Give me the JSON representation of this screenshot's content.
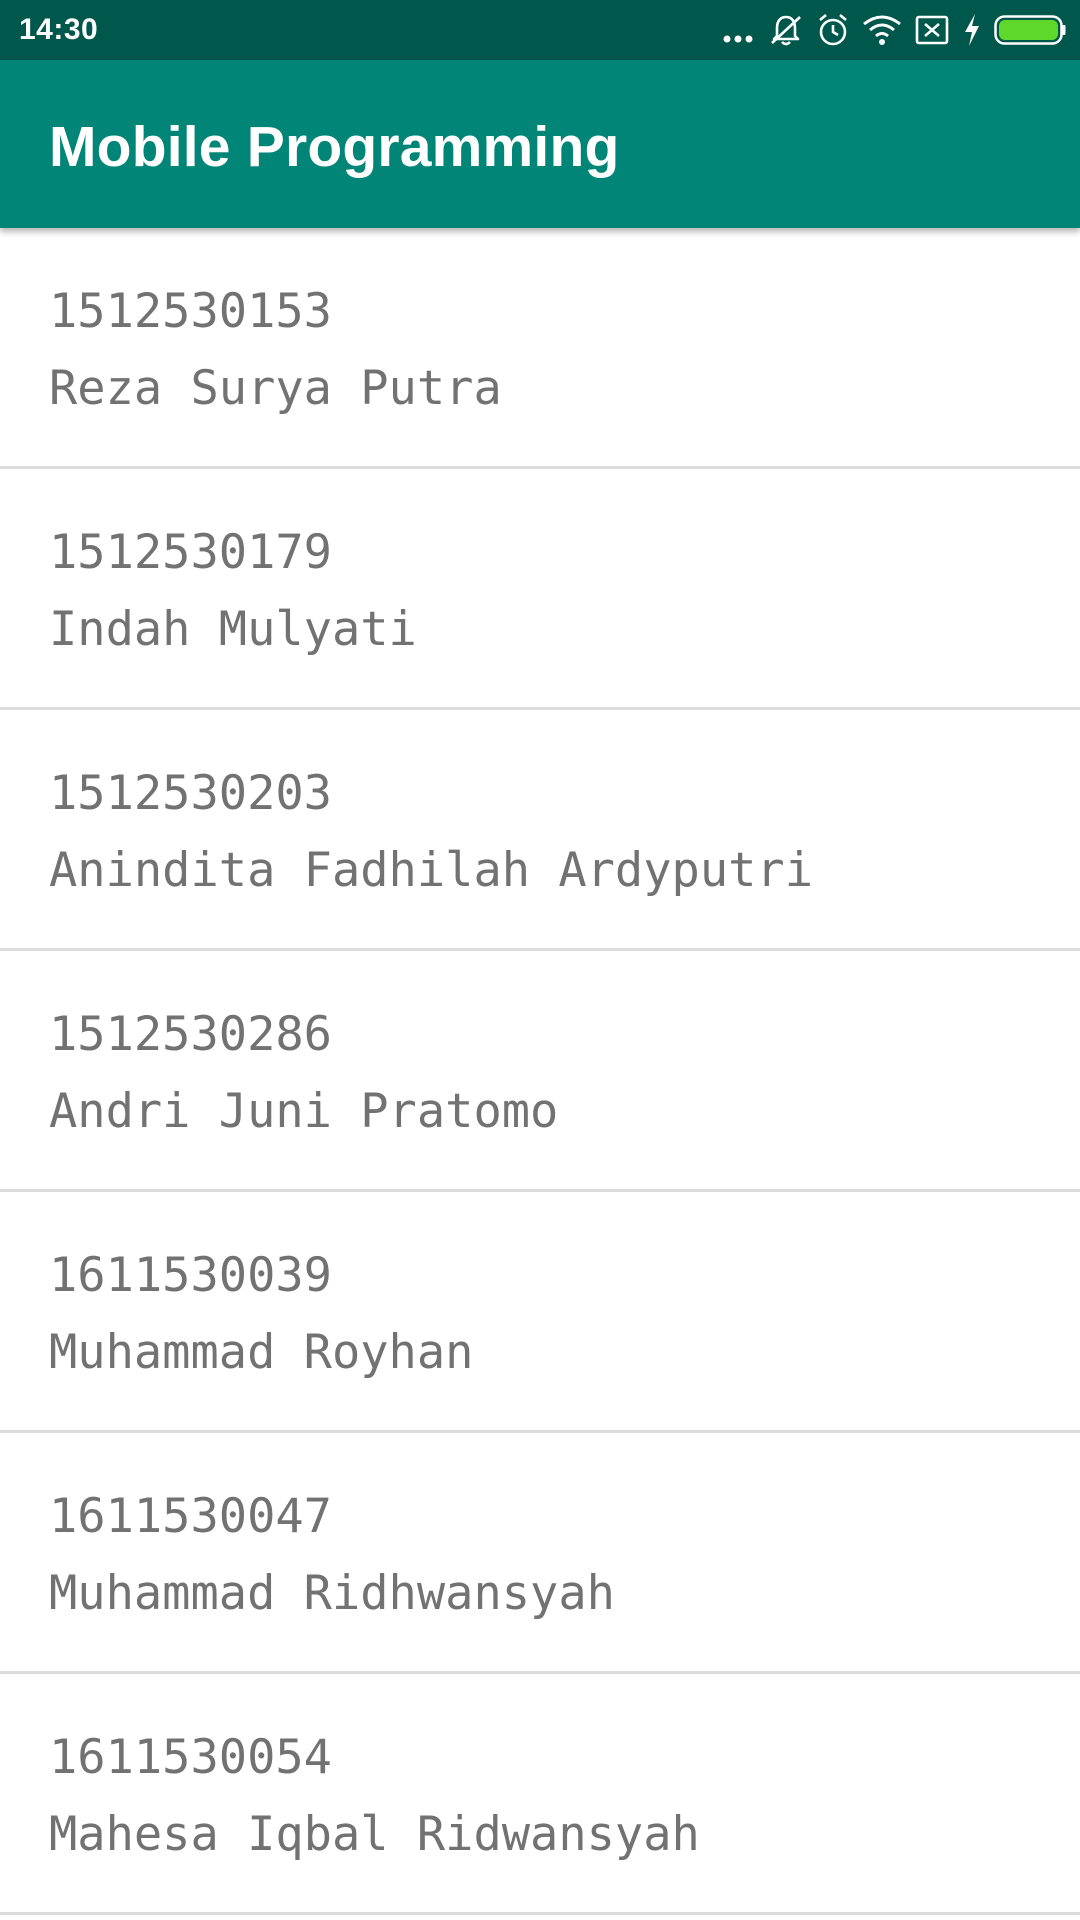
{
  "status_bar": {
    "time": "14:30",
    "icons": [
      "more-dots-icon",
      "notifications-off-icon",
      "alarm-icon",
      "wifi-icon",
      "no-sim-icon",
      "charging-bolt-icon",
      "battery-full-icon"
    ]
  },
  "app_bar": {
    "title": "Mobile Programming"
  },
  "students": [
    {
      "nim": "1512530153",
      "name": "Reza Surya Putra"
    },
    {
      "nim": "1512530179",
      "name": "Indah Mulyati"
    },
    {
      "nim": "1512530203",
      "name": "Anindita Fadhilah Ardyputri"
    },
    {
      "nim": "1512530286",
      "name": "Andri Juni Pratomo"
    },
    {
      "nim": "1611530039",
      "name": "Muhammad Royhan"
    },
    {
      "nim": "1611530047",
      "name": "Muhammad Ridhwansyah"
    },
    {
      "nim": "1611530054",
      "name": "Mahesa Iqbal Ridwansyah"
    }
  ],
  "colors": {
    "status_bar": "#00574b",
    "app_bar": "#008577",
    "list_text": "#727272",
    "divider": "#dcdcdc",
    "battery": "#5ed82a"
  }
}
